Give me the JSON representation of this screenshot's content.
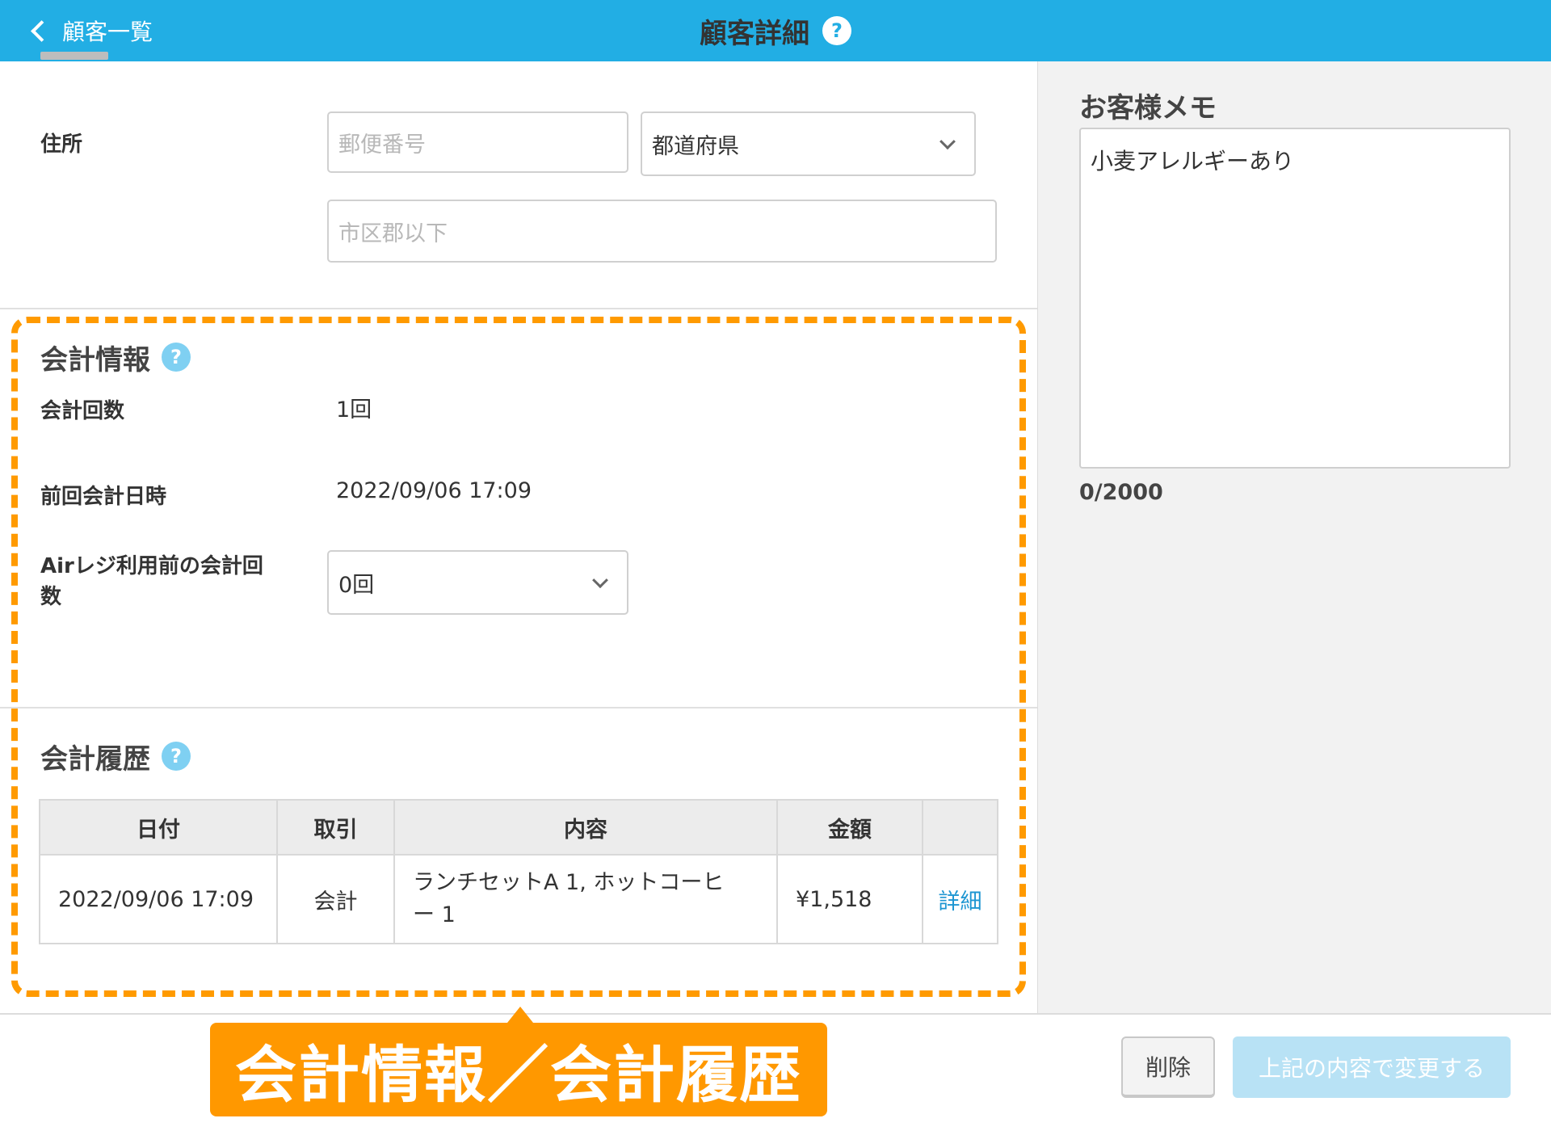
{
  "header": {
    "back_label": "顧客一覧",
    "title": "顧客詳細",
    "help": "?"
  },
  "address": {
    "label": "住所",
    "postal_placeholder": "郵便番号",
    "prefecture_value": "都道府県",
    "city_placeholder": "市区郡以下"
  },
  "account_info": {
    "title": "会計情報",
    "help": "?",
    "visits_label": "会計回数",
    "visits_value": "1回",
    "last_label": "前回会計日時",
    "last_value": "2022/09/06 17:09",
    "prior_label_line1": "Airレジ利用前の会計回",
    "prior_label_line2": "数",
    "prior_value": "0回"
  },
  "history": {
    "title": "会計履歴",
    "help": "?",
    "columns": [
      "日付",
      "取引",
      "内容",
      "金額",
      ""
    ],
    "rows": [
      {
        "date": "2022/09/06 17:09",
        "type": "会計",
        "content_line1": "ランチセットA 1, ホットコーヒ",
        "content_line2": "ー 1",
        "amount": "¥1,518",
        "link": "詳細"
      }
    ]
  },
  "memo": {
    "label": "お客様メモ",
    "value": "小麦アレルギーあり",
    "count": "0/2000"
  },
  "callout": "会計情報／会計履歴",
  "footer": {
    "delete_label": "削除",
    "save_label": "上記の内容で変更する"
  },
  "colors": {
    "header": "#22aee4",
    "highlight": "#ff9800",
    "link": "#1e96d2",
    "save_disabled": "#b8e2f5"
  }
}
